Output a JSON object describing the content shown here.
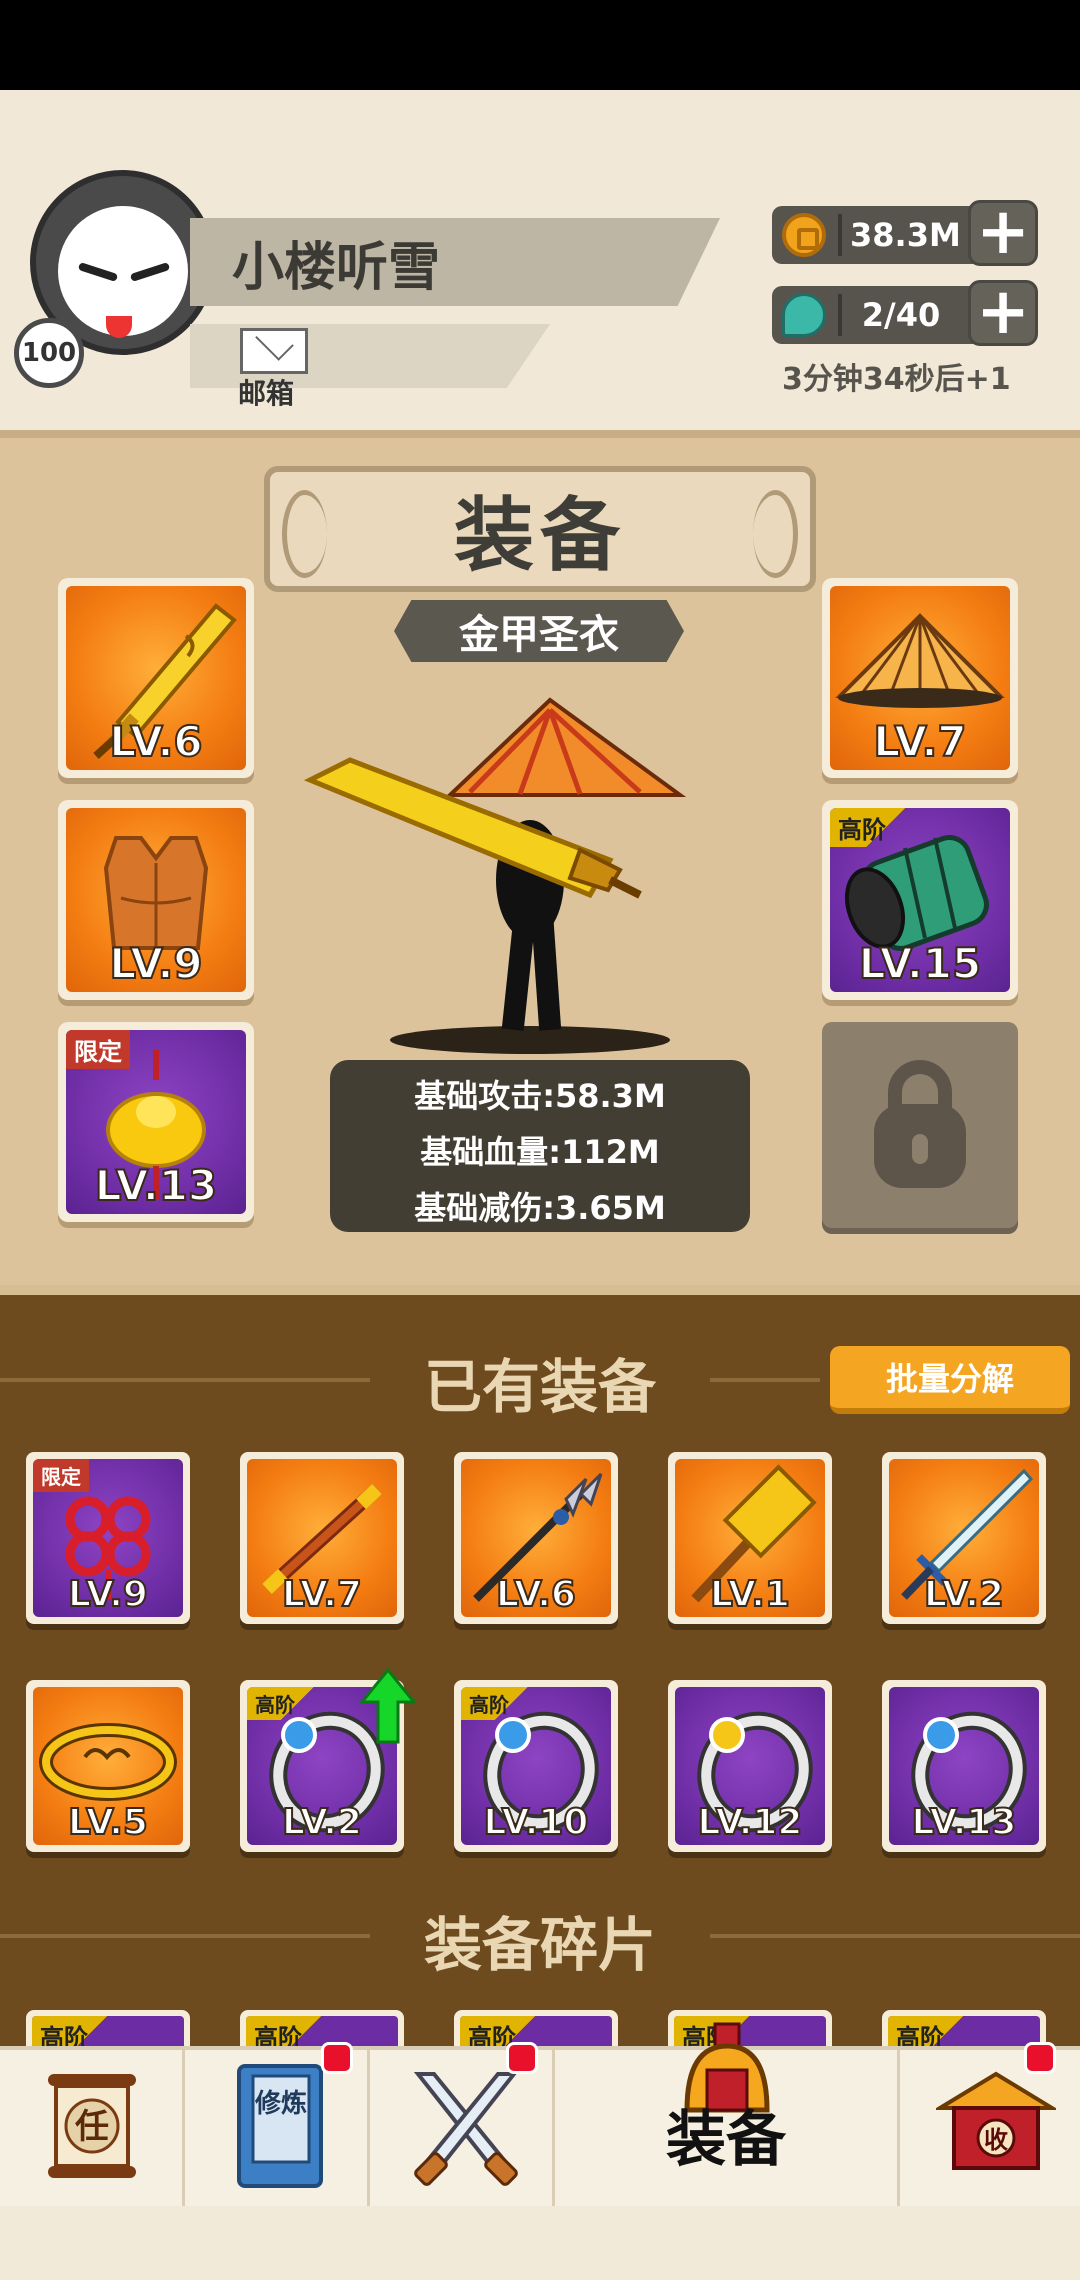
{
  "player": {
    "name": "小楼听雪",
    "level": "100",
    "mail_label": "邮箱"
  },
  "resources": {
    "coins": "38.3M",
    "stamina": "2/40",
    "regen": "3分钟34秒后+1"
  },
  "equipment": {
    "title": "装备",
    "set_name": "金甲圣衣",
    "slots": [
      {
        "name": "golden-sword",
        "level": "LV.6",
        "bg": "orange",
        "tag": ""
      },
      {
        "name": "vest",
        "level": "LV.9",
        "bg": "orange",
        "tag": ""
      },
      {
        "name": "gold-ingot-pendant",
        "level": "LV.13",
        "bg": "purple",
        "tag": "限定"
      },
      {
        "name": "straw-hat",
        "level": "LV.7",
        "bg": "orange",
        "tag": ""
      },
      {
        "name": "bracer",
        "level": "LV.15",
        "bg": "purple",
        "tag": "高阶"
      }
    ],
    "stats": [
      "基础攻击:58.3M",
      "基础血量:112M",
      "基础减伤:3.65M"
    ]
  },
  "inventory": {
    "title": "已有装备",
    "batch_button": "批量分解",
    "items": [
      {
        "name": "chinese-knot",
        "level": "LV.9",
        "bg": "purple",
        "tag": "限定"
      },
      {
        "name": "staff",
        "level": "LV.7",
        "bg": "orange",
        "tag": ""
      },
      {
        "name": "trident-spear",
        "level": "LV.6",
        "bg": "orange",
        "tag": ""
      },
      {
        "name": "hammer",
        "level": "LV.1",
        "bg": "orange",
        "tag": ""
      },
      {
        "name": "ice-sword",
        "level": "LV.2",
        "bg": "orange",
        "tag": ""
      },
      {
        "name": "gold-headband",
        "level": "LV.5",
        "bg": "orange",
        "tag": ""
      },
      {
        "name": "ring-blue",
        "level": "LV.2",
        "bg": "purple",
        "tag": "高阶"
      },
      {
        "name": "ring-blue",
        "level": "LV.10",
        "bg": "purple",
        "tag": "高阶"
      },
      {
        "name": "ring-gold",
        "level": "LV.12",
        "bg": "purple",
        "tag": ""
      },
      {
        "name": "ring-blue",
        "level": "LV.13",
        "bg": "purple",
        "tag": ""
      }
    ],
    "fragments_title": "装备碎片",
    "fragments": [
      "高阶",
      "高阶",
      "高阶",
      "高阶",
      "高阶"
    ]
  },
  "nav": {
    "tasks_glyph": "任",
    "cultivate_glyph": "修炼",
    "equip_label": "装备",
    "collect_glyph": "收"
  },
  "colors": {
    "accent_orange": "#f4a623",
    "purple_rarity": "#6c2ca3",
    "orange_rarity": "#f47d12",
    "badge_red": "#e8102a"
  }
}
